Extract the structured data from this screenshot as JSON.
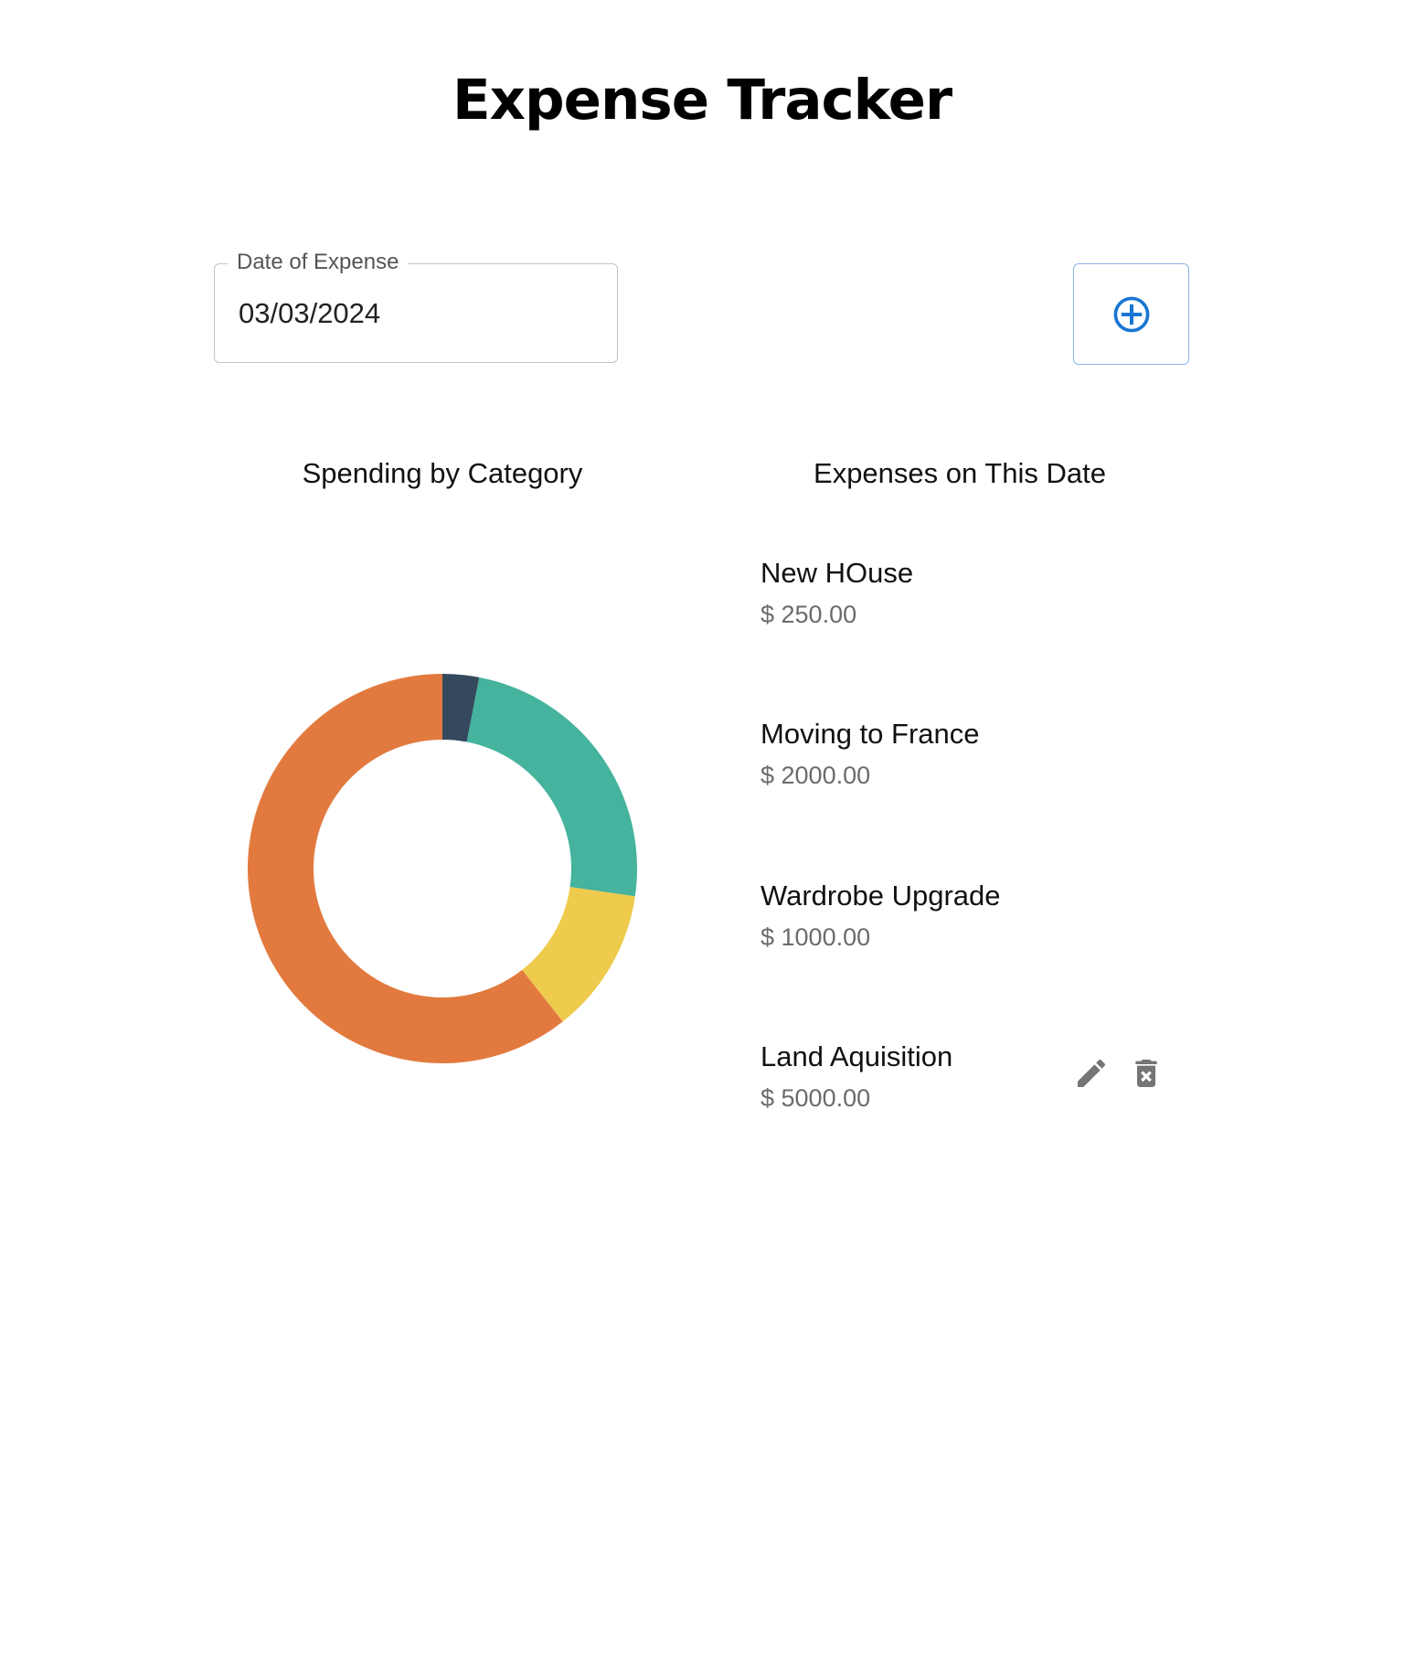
{
  "header": {
    "title": "Expense Tracker"
  },
  "date_picker": {
    "label": "Date of Expense",
    "value": "03/03/2024"
  },
  "add_button": {
    "icon": "add-circle-icon",
    "color": "#1976d2"
  },
  "chart_panel": {
    "title": "Spending by Category"
  },
  "list_panel": {
    "title": "Expenses on This Date"
  },
  "expenses": [
    {
      "name": "New HOuse",
      "amount": "$ 250.00"
    },
    {
      "name": "Moving to France",
      "amount": "$ 2000.00"
    },
    {
      "name": "Wardrobe Upgrade",
      "amount": "$ 1000.00"
    },
    {
      "name": "Land Aquisition",
      "amount": "$ 5000.00"
    }
  ],
  "row_actions": {
    "edit_icon": "pencil-icon",
    "delete_icon": "trash-icon",
    "color": "#757575"
  },
  "chart_data": {
    "type": "pie",
    "style": "doughnut",
    "legend": "none",
    "values": [
      250,
      2000,
      1000,
      5000
    ],
    "colors": [
      "#34495e",
      "#45b39d",
      "#eeca4d",
      "#e27a3f"
    ]
  }
}
